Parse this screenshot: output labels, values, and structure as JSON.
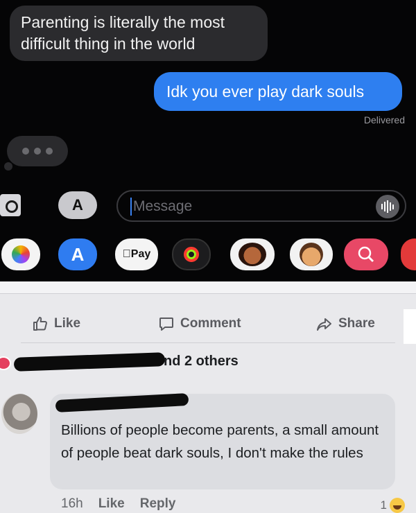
{
  "imessage": {
    "incoming_text": "Parenting is literally the most difficult thing in the world",
    "outgoing_text": "Idk you ever play dark souls",
    "status": "Delivered",
    "input_placeholder": "Message",
    "tray": {
      "pay_label": "Pay",
      "appstore_glyph": "A"
    }
  },
  "facebook": {
    "actions": {
      "like_label": "Like",
      "comment_label": "Comment",
      "share_label": "Share"
    },
    "reactions_text": "nd 2 others",
    "comment": {
      "text": "Billions of people become parents, a small amount of people beat dark souls, I don't make the rules",
      "time": "16h",
      "like_label": "Like",
      "reply_label": "Reply",
      "reaction_count": "1"
    },
    "colors": {
      "heart_reaction": "#e4405f",
      "haha_reaction": "#f7c846"
    }
  },
  "colors": {
    "imessage_blue": "#2e7ff0",
    "incoming_bubble": "#2b2b2e",
    "fb_comment_bubble": "#dcdde1"
  }
}
